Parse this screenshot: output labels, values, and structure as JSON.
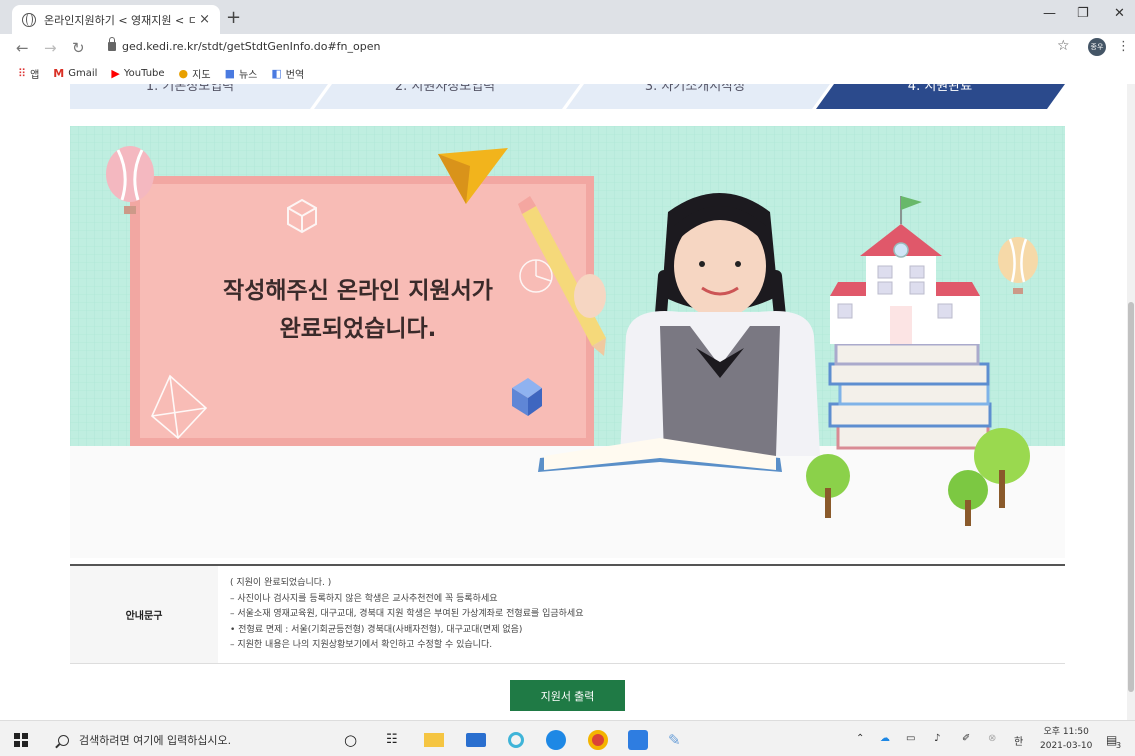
{
  "browser": {
    "tab_title": "온라인지원하기 < 영재지원 < ㄷ",
    "tab_close": "×",
    "new_tab": "+",
    "url": "ged.kedi.re.kr/stdt/getStdtGenInfo.do#fn_open",
    "avatar_text": "종우",
    "bookmarks": [
      "앱",
      "Gmail",
      "YouTube",
      "지도",
      "뉴스",
      "번역"
    ]
  },
  "steps": [
    "1. 기본정보입력",
    "2. 지원자정보입력",
    "3. 자기소개서작성",
    "4. 지원완료"
  ],
  "banner": {
    "message_line1": "작성해주신 온라인 지원서가",
    "message_line2": "완료되었습니다."
  },
  "notice": {
    "label": "안내문구",
    "lines": [
      "( 지원이 완료되었습니다. )",
      "– 사진이나 검사지를 등록하지 않은 학생은 교사추천전에 꼭 등록하세요",
      "– 서울소재 영재교육원, 대구교대, 경북대 지원 학생은 부여된 가상계좌로 전형료를 입금하세요",
      "• 전형료 면제 : 서울(기회균등전형) 경북대(사배자전형), 대구교대(면제 없음)",
      "– 지원한 내용은 나의 지원상황보기에서 확인하고 수정할 수 있습니다."
    ]
  },
  "print_button": "지원서 출력",
  "taskbar": {
    "search_placeholder": "검색하려면 여기에 입력하십시오.",
    "ime": "한",
    "time": "오후 11:50",
    "date": "2021-03-10",
    "notification_count": "3"
  },
  "colors": {
    "active_step": "#2b4a8c",
    "inactive_step": "#e4ecf7",
    "banner_bg": "#bfeee0",
    "board": "#f6b2ad",
    "print_button": "#1f7a45"
  }
}
